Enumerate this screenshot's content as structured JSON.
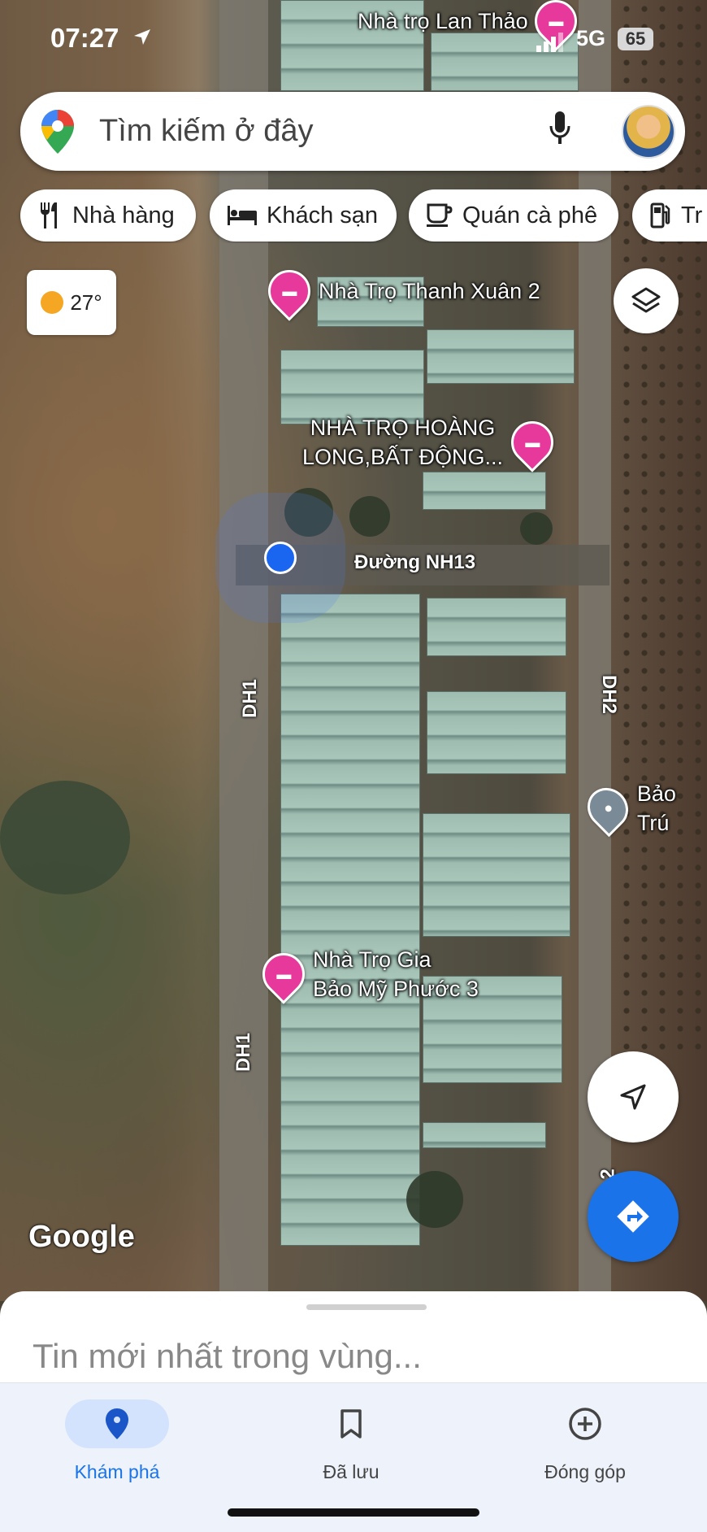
{
  "status_bar": {
    "time": "07:27",
    "network": "5G",
    "battery": "65"
  },
  "search": {
    "placeholder": "Tìm kiếm ở đây",
    "icons": [
      "google-maps-pin-icon",
      "mic-icon",
      "avatar"
    ]
  },
  "chips": [
    {
      "label": "Nhà hàng",
      "icon": "fork-knife-icon"
    },
    {
      "label": "Khách sạn",
      "icon": "bed-icon"
    },
    {
      "label": "Quán cà phê",
      "icon": "coffee-icon"
    },
    {
      "label": "Tr",
      "icon": "gas-station-icon"
    }
  ],
  "weather": {
    "temp": "27°",
    "icon": "sun-icon"
  },
  "map": {
    "pois": [
      {
        "line1": "Nhà trọ Lan Thảo",
        "line2": ""
      },
      {
        "line1": "Nhà Trọ Thanh Xuân 2",
        "line2": ""
      },
      {
        "line1": "NHÀ TRỌ HOÀNG",
        "line2": "LONG,BẤT ĐỘNG..."
      },
      {
        "line1": "Nhà Trọ Gia",
        "line2": "Bảo Mỹ Phước 3"
      },
      {
        "line1": "Bảo Trú",
        "line2": ""
      }
    ],
    "roads": {
      "main": "Đường NH13",
      "dh1": "DH1",
      "dh2": "DH2",
      "dh2b": "2"
    },
    "attribution": "Google"
  },
  "sheet": {
    "title": "Tin mới nhất trong vùng..."
  },
  "bottom_nav": [
    {
      "label": "Khám phá",
      "icon": "explore-pin-icon",
      "active": true
    },
    {
      "label": "Đã lưu",
      "icon": "bookmark-icon",
      "active": false
    },
    {
      "label": "Đóng góp",
      "icon": "add-circle-icon",
      "active": false
    }
  ],
  "colors": {
    "accent": "#1a73e8",
    "poi": "#e6399b",
    "nav_active_bg": "#d3e3fd"
  }
}
